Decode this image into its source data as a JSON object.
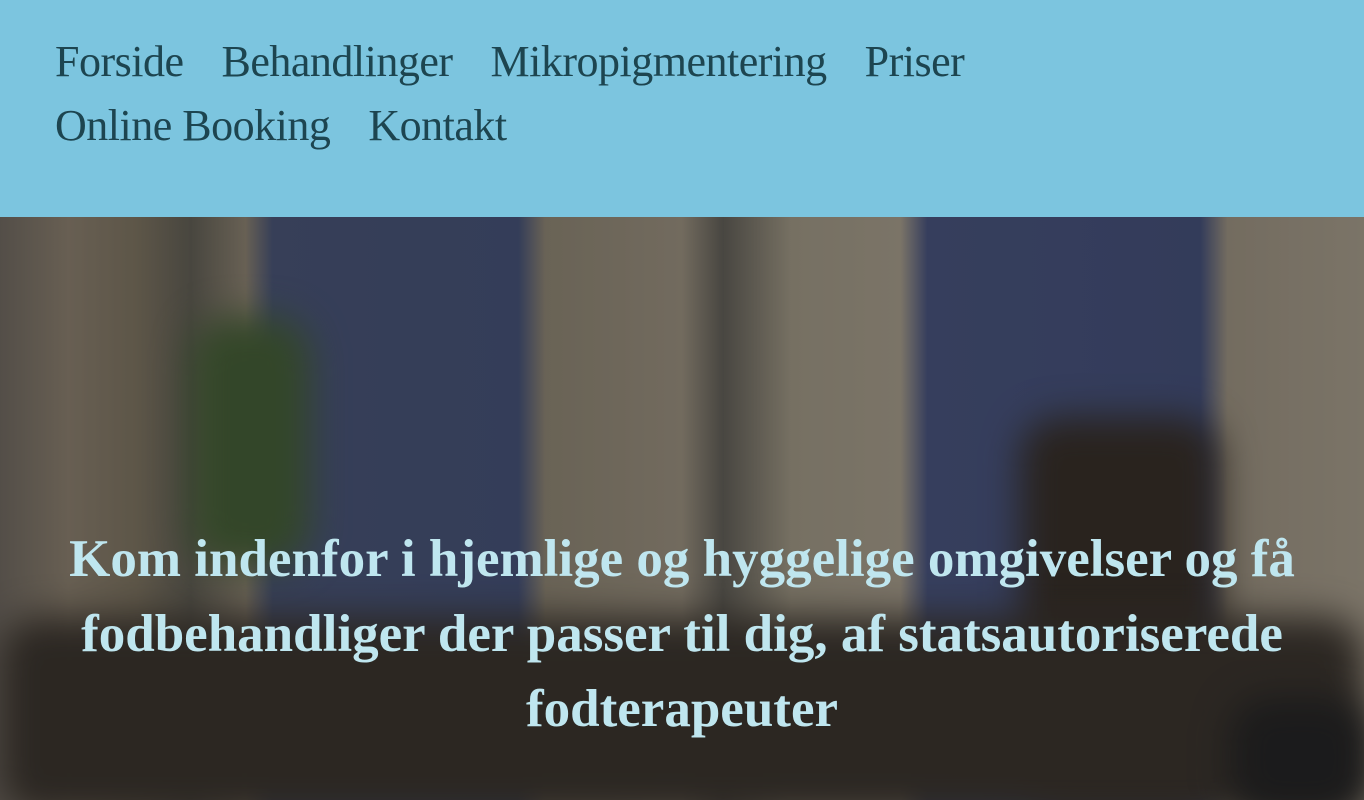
{
  "nav": {
    "items": [
      "Forside",
      "Behandlinger",
      "Mikropigmentering",
      "Priser",
      "Online Booking",
      "Kontakt"
    ]
  },
  "hero": {
    "headline": "Kom indenfor i hjemlige og hyggelige omgivelser og få fodbehandliger der passer til dig, af statsautoriserede fodterapeuter"
  },
  "colors": {
    "nav_bg": "#7cc5df",
    "nav_text": "#1d4550",
    "headline": "#bfe6ef"
  }
}
